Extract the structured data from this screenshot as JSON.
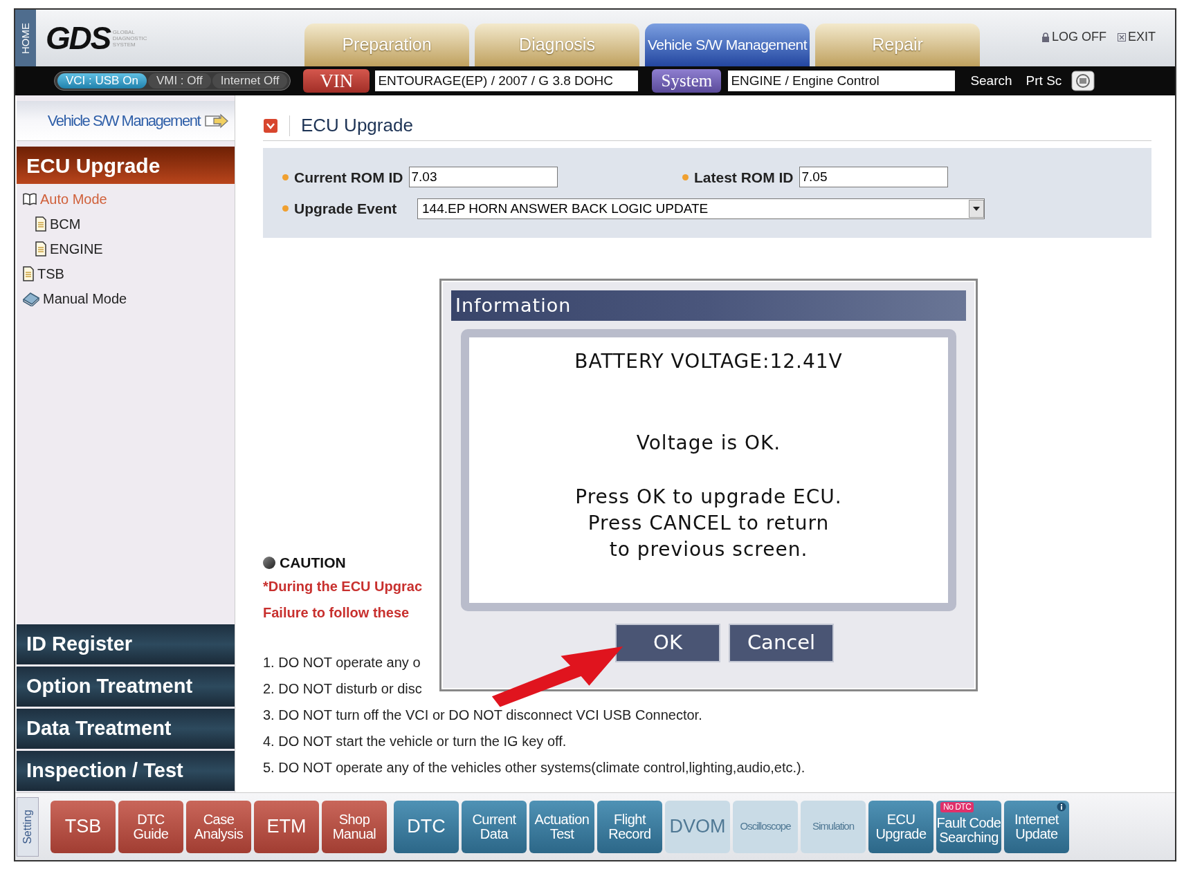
{
  "header": {
    "home": "HOME",
    "logo": "GDS",
    "logo_subtitle": [
      "GLOBAL",
      "DIAGNOSTIC",
      "SYSTEM"
    ],
    "tabs": [
      {
        "label": "Preparation",
        "selected": false
      },
      {
        "label": "Diagnosis",
        "selected": false
      },
      {
        "label": "Vehicle S/W Management",
        "selected": true
      },
      {
        "label": "Repair",
        "selected": false
      }
    ],
    "links": [
      {
        "label": "LOG OFF",
        "kind": "lock"
      },
      {
        "label": "EXIT",
        "kind": "close"
      }
    ]
  },
  "toolbar": {
    "status": [
      {
        "label": "VCI : USB On",
        "on": true
      },
      {
        "label": "VMI : Off",
        "on": false
      },
      {
        "label": "Internet Off",
        "on": false
      }
    ],
    "vin_label": "VIN",
    "vin_value": "ENTOURAGE(EP) / 2007 / G 3.8 DOHC",
    "system_label": "System",
    "system_value": "ENGINE / Engine Control",
    "search": "Search",
    "print": "Prt Sc"
  },
  "sidebar": {
    "title": "Vehicle S/W Management",
    "sections": [
      {
        "label": "ECU Upgrade",
        "selected": true
      },
      {
        "label": "ID Register",
        "selected": false
      },
      {
        "label": "Option Treatment",
        "selected": false
      },
      {
        "label": "Data Treatment",
        "selected": false
      },
      {
        "label": "Inspection / Test",
        "selected": false
      }
    ],
    "tree": [
      {
        "label": "Auto Mode",
        "kind": "folder",
        "selected": true,
        "children": [
          {
            "label": "BCM",
            "kind": "document",
            "selected": false
          },
          {
            "label": "ENGINE",
            "kind": "document",
            "selected": false
          }
        ]
      },
      {
        "label": "TSB",
        "kind": "document",
        "selected": false
      },
      {
        "label": "Manual Mode",
        "kind": "book",
        "selected": false
      }
    ]
  },
  "content": {
    "title": "ECU Upgrade",
    "current_rom": {
      "label": "Current ROM ID",
      "value": "7.03"
    },
    "latest_rom": {
      "label": "Latest ROM ID",
      "value": "7.05"
    },
    "upgrade_event": {
      "label": "Upgrade Event",
      "value": "144.EP HORN ANSWER BACK LOGIC UPDATE"
    },
    "caution": {
      "title": "CAUTION",
      "warnings": [
        "*During the ECU Upgrac",
        "Failure to follow these"
      ],
      "steps": [
        "1. DO NOT operate any o",
        "2. DO NOT disturb or disc",
        "3. DO NOT turn off the VCI or DO NOT disconnect VCI USB Connector.",
        "4. DO NOT start the vehicle or turn the IG key off.",
        "5. DO NOT operate any of the vehicles other systems(climate control,lighting,audio,etc.)."
      ]
    }
  },
  "dialog": {
    "title": "Information",
    "heading": "BATTERY VOLTAGE:12.41V",
    "status": "Voltage is OK.",
    "instructions": [
      "Press OK to upgrade ECU.",
      "Press CANCEL to return",
      "to previous screen."
    ],
    "buttons": [
      "OK",
      "Cancel"
    ]
  },
  "bottom": {
    "setting": "Setting",
    "buttons": [
      {
        "lines": [
          "TSB"
        ],
        "kind": "service",
        "disabled": false
      },
      {
        "lines": [
          "DTC",
          "Guide"
        ],
        "kind": "service",
        "disabled": false
      },
      {
        "lines": [
          "Case",
          "Analysis"
        ],
        "kind": "service",
        "disabled": false
      },
      {
        "lines": [
          "ETM"
        ],
        "kind": "service",
        "disabled": false
      },
      {
        "lines": [
          "Shop",
          "Manual"
        ],
        "kind": "service",
        "disabled": false
      },
      {
        "lines": [
          "DTC"
        ],
        "kind": "diagnostic",
        "disabled": false
      },
      {
        "lines": [
          "Current",
          "Data"
        ],
        "kind": "diagnostic",
        "disabled": false
      },
      {
        "lines": [
          "Actuation",
          "Test"
        ],
        "kind": "diagnostic",
        "disabled": false
      },
      {
        "lines": [
          "Flight",
          "Record"
        ],
        "kind": "diagnostic",
        "disabled": false
      },
      {
        "lines": [
          "DVOM"
        ],
        "kind": "diagnostic",
        "disabled": true
      },
      {
        "lines": [
          "Oscilloscope"
        ],
        "kind": "diagnostic",
        "disabled": true
      },
      {
        "lines": [
          "Simulation"
        ],
        "kind": "diagnostic",
        "disabled": true
      },
      {
        "lines": [
          "ECU",
          "Upgrade"
        ],
        "kind": "tool",
        "disabled": false
      },
      {
        "lines": [
          "Fault Code",
          "Searching"
        ],
        "kind": "tool",
        "disabled": false,
        "badge": "No DTC"
      },
      {
        "lines": [
          "Internet",
          "Update"
        ],
        "kind": "tool",
        "disabled": false,
        "info": true
      }
    ]
  }
}
